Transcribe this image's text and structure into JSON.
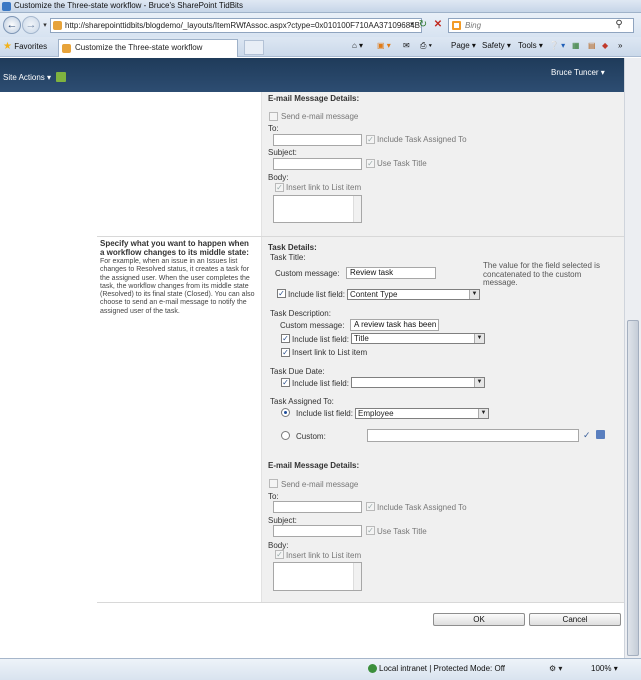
{
  "window": {
    "title": "Customize the Three-state workflow - Bruce's SharePoint TidBits"
  },
  "browser": {
    "address": "http://sharepointtidbits/blogdemo/_layouts/ItemRWfAssoc.aspx?ctype=0x010100F710AA37109684B9",
    "search_placeholder": "Bing",
    "favorites_label": "Favorites",
    "tab_title": "Customize the Three-state workflow",
    "page_menu": "Page",
    "safety_menu": "Safety",
    "tools_menu": "Tools"
  },
  "sharepoint": {
    "site_actions": "Site Actions",
    "user_name": "Bruce Tuncer"
  },
  "email_section_1": {
    "header": "E-mail Message Details:",
    "send_label": "Send e-mail message",
    "to_label": "To:",
    "include_assigned_label": "Include Task Assigned To",
    "subject_label": "Subject:",
    "use_task_title_label": "Use Task Title",
    "body_label": "Body:",
    "insert_link_label": "Insert link to List item"
  },
  "middle_state": {
    "heading": "Specify what you want to happen when a workflow changes to its middle state:",
    "description": "For example, when an issue in an Issues list changes to Resolved status, it creates a task for the assigned user. When the user completes the task, the workflow changes from its middle state (Resolved) to its final state (Closed). You can also choose to send an e-mail message to notify the assigned user of the task."
  },
  "task_details": {
    "header": "Task Details:",
    "task_title_label": "Task Title:",
    "custom_message_label": "Custom message:",
    "custom_message_value": "Review task",
    "include_field_label": "Include list field:",
    "include_field_value": "Content Type",
    "note": "The value for the field selected is concatenated to the custom message.",
    "task_description_label": "Task Description:",
    "desc_custom_message_label": "Custom message:",
    "desc_custom_message_value": "A review task has been",
    "desc_include_field_label": "Include list field:",
    "desc_include_field_value": "Title",
    "desc_insert_link_label": "Insert link to List item",
    "due_date_label": "Task Due Date:",
    "due_include_field_label": "Include list field:",
    "due_include_field_value": "",
    "assigned_to_label": "Task Assigned To:",
    "assigned_include_field_label": "Include list field:",
    "assigned_include_field_value": "Employee",
    "custom_label": "Custom:"
  },
  "email_section_2": {
    "header": "E-mail Message Details:",
    "send_label": "Send e-mail message",
    "to_label": "To:",
    "include_assigned_label": "Include Task Assigned To",
    "subject_label": "Subject:",
    "use_task_title_label": "Use Task Title",
    "body_label": "Body:",
    "insert_link_label": "Insert link to List item"
  },
  "buttons": {
    "ok": "OK",
    "cancel": "Cancel"
  },
  "status": {
    "zone": "Local intranet | Protected Mode: Off",
    "zoom": "100%"
  }
}
